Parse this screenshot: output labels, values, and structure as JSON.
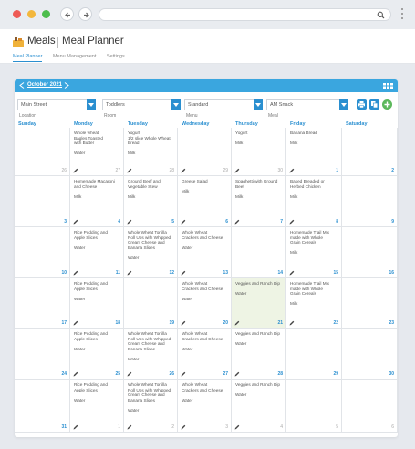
{
  "app": {
    "title": "Meals",
    "subtitle": "Meal Planner",
    "subnav": [
      "Meal Planner",
      "Menu Management",
      "Settings"
    ]
  },
  "toolbar": {
    "month": "October 2021",
    "filters": [
      {
        "value": "Main Street",
        "label": "Location"
      },
      {
        "value": "Toddlers",
        "label": "Room"
      },
      {
        "value": "Standard",
        "label": "Menu"
      },
      {
        "value": "AM Snack",
        "label": "Meal"
      }
    ]
  },
  "days": [
    "Sunday",
    "Monday",
    "Tuesday",
    "Wednesday",
    "Thursday",
    "Friday",
    "Saturday"
  ],
  "weeks": [
    [
      {
        "num": "26",
        "muted": true,
        "text": "",
        "pencil": false
      },
      {
        "num": "27",
        "muted": true,
        "text": "Whole wheat\nBagles Toasted\nwith Butter\n\nWater",
        "pencil": true
      },
      {
        "num": "28",
        "muted": true,
        "text": "Yogurt\n1/2 slice Whole Wheat\nBread\n\nMilk",
        "pencil": true
      },
      {
        "num": "29",
        "muted": true,
        "text": "",
        "pencil": true
      },
      {
        "num": "30",
        "muted": true,
        "text": "Yogurt\n\nMilk",
        "pencil": true
      },
      {
        "num": "1",
        "muted": false,
        "text": "Banana Bread\n\nMilk",
        "pencil": true
      },
      {
        "num": "2",
        "muted": false,
        "text": "",
        "pencil": false
      }
    ],
    [
      {
        "num": "3",
        "muted": false,
        "text": "",
        "pencil": false
      },
      {
        "num": "4",
        "muted": false,
        "text": "Homemade Macaroni\nand Cheese\n\nMilk",
        "pencil": true
      },
      {
        "num": "5",
        "muted": false,
        "text": "Ground Beef and\nVegetable Stew\n\nMilk",
        "pencil": true
      },
      {
        "num": "6",
        "muted": false,
        "text": "Greese Salad\n\nMilk",
        "pencil": true
      },
      {
        "num": "7",
        "muted": false,
        "text": "Spaghetti with Ground\nBeef\n\nMilk",
        "pencil": true
      },
      {
        "num": "8",
        "muted": false,
        "text": "Baked Breaded or\nHerbed Chicken\n\nMilk",
        "pencil": true
      },
      {
        "num": "9",
        "muted": false,
        "text": "",
        "pencil": false
      }
    ],
    [
      {
        "num": "10",
        "muted": false,
        "text": "",
        "pencil": false
      },
      {
        "num": "11",
        "muted": false,
        "text": "Rice Pudding and\nApple Slices\n\nWater",
        "pencil": true
      },
      {
        "num": "12",
        "muted": false,
        "text": "Whole Wheat Tortilla\nRoll Ups with Whipped\nCream Cheese and\nBanana Slices\n\nWater",
        "pencil": true
      },
      {
        "num": "13",
        "muted": false,
        "text": "Whole Wheat\nCrackers and Cheese\n\nWater",
        "pencil": true
      },
      {
        "num": "14",
        "muted": false,
        "text": "",
        "pencil": false
      },
      {
        "num": "15",
        "muted": false,
        "text": "Homemade Trail Mix\nmade with Whole\nGrain Cereals\n\nMilk",
        "pencil": true
      },
      {
        "num": "16",
        "muted": false,
        "text": "",
        "pencil": false
      }
    ],
    [
      {
        "num": "17",
        "muted": false,
        "text": "",
        "pencil": false
      },
      {
        "num": "18",
        "muted": false,
        "text": "Rice Pudding and\nApple Slices\n\nWater",
        "pencil": true
      },
      {
        "num": "19",
        "muted": false,
        "text": "",
        "pencil": false
      },
      {
        "num": "20",
        "muted": false,
        "text": "Whole Wheat\nCrackers and Cheese\n\nWater",
        "pencil": true
      },
      {
        "num": "21",
        "muted": false,
        "today": true,
        "text": "Veggies and Ranch Dip\n\nWater",
        "pencil": true
      },
      {
        "num": "22",
        "muted": false,
        "text": "Homemade Trail Mix\nmade with Whole\nGrain Cereals\n\nMilk",
        "pencil": true
      },
      {
        "num": "23",
        "muted": false,
        "text": "",
        "pencil": false
      }
    ],
    [
      {
        "num": "24",
        "muted": false,
        "text": "",
        "pencil": false
      },
      {
        "num": "25",
        "muted": false,
        "text": "Rice Pudding and\nApple Slices\n\nWater",
        "pencil": true
      },
      {
        "num": "26",
        "muted": false,
        "text": "Whole Wheat Tortilla\nRoll Ups with Whipped\nCream Cheese and\nBanana Slices\n\nWater",
        "pencil": true
      },
      {
        "num": "27",
        "muted": false,
        "text": "Whole Wheat\nCrackers and Cheese\n\nWater",
        "pencil": true
      },
      {
        "num": "28",
        "muted": false,
        "text": "Veggies and Ranch Dip\n\nWater",
        "pencil": true
      },
      {
        "num": "29",
        "muted": false,
        "text": "",
        "pencil": false
      },
      {
        "num": "30",
        "muted": false,
        "text": "",
        "pencil": false
      }
    ],
    [
      {
        "num": "31",
        "muted": false,
        "text": "",
        "pencil": false
      },
      {
        "num": "1",
        "muted": true,
        "text": "Rice Pudding and\nApple Slices\n\nWater",
        "pencil": true
      },
      {
        "num": "2",
        "muted": true,
        "text": "Whole Wheat Tortilla\nRoll Ups with Whipped\nCream Cheese and\nBanana Slices\n\nWater",
        "pencil": true
      },
      {
        "num": "3",
        "muted": true,
        "text": "Whole Wheat\nCrackers and Cheese\n\nWater",
        "pencil": true
      },
      {
        "num": "4",
        "muted": true,
        "text": "Veggies and Ranch Dip\n\nWater",
        "pencil": true
      },
      {
        "num": "5",
        "muted": true,
        "text": "",
        "pencil": false
      },
      {
        "num": "6",
        "muted": true,
        "text": "",
        "pencil": false
      }
    ]
  ],
  "colors": {
    "accent": "#2a8fd0",
    "bar": "#3aa6df",
    "today": "#eef4e4",
    "green": "#5cb85c"
  }
}
